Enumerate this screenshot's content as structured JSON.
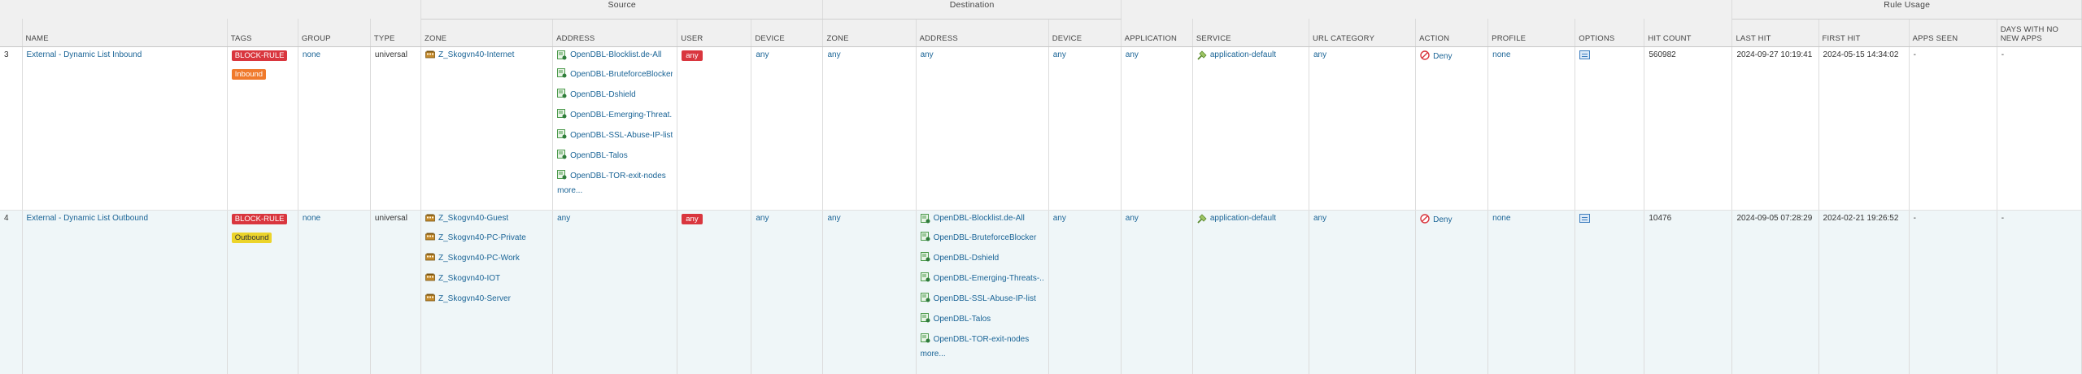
{
  "groups": {
    "source": "Source",
    "destination": "Destination",
    "rule_usage": "Rule Usage"
  },
  "columns": {
    "name": "NAME",
    "tags": "TAGS",
    "group": "GROUP",
    "type": "TYPE",
    "src_zone": "ZONE",
    "src_address": "ADDRESS",
    "src_user": "USER",
    "src_device": "DEVICE",
    "dst_zone": "ZONE",
    "dst_address": "ADDRESS",
    "dst_device": "DEVICE",
    "application": "APPLICATION",
    "service": "SERVICE",
    "url_category": "URL CATEGORY",
    "action": "ACTION",
    "profile": "PROFILE",
    "options": "OPTIONS",
    "hit_count": "HIT COUNT",
    "last_hit": "LAST HIT",
    "first_hit": "FIRST HIT",
    "apps_seen": "APPS SEEN",
    "days_no_new": "DAYS WITH NO NEW APPS"
  },
  "rows": [
    {
      "num": "3",
      "name": "External - Dynamic List Inbound",
      "tags": [
        "BLOCK-RULE",
        "Inbound"
      ],
      "group": "none",
      "type": "universal",
      "src_zone": [
        "Z_Skogvn40-Internet"
      ],
      "src_address": [
        "OpenDBL-Blocklist.de-All",
        "OpenDBL-BruteforceBlocker",
        "OpenDBL-Dshield",
        "OpenDBL-Emerging-Threat...",
        "OpenDBL-SSL-Abuse-IP-list",
        "OpenDBL-Talos",
        "OpenDBL-TOR-exit-nodes"
      ],
      "src_address_more": "more...",
      "src_user": "any",
      "src_device": "any",
      "dst_zone": "any",
      "dst_address": "any",
      "dst_device": "any",
      "application": "any",
      "service": "application-default",
      "url_category": "any",
      "action": "Deny",
      "profile": "none",
      "hit_count": "560982",
      "last_hit": "2024-09-27 10:19:41",
      "first_hit": "2024-05-15 14:34:02",
      "apps_seen": "-",
      "days_no_new": "-"
    },
    {
      "num": "4",
      "name": "External - Dynamic List Outbound",
      "tags": [
        "BLOCK-RULE",
        "Outbound"
      ],
      "group": "none",
      "type": "universal",
      "src_zone": [
        "Z_Skogvn40-Guest",
        "Z_Skogvn40-PC-Private",
        "Z_Skogvn40-PC-Work",
        "Z_Skogvn40-IOT",
        "Z_Skogvn40-Server"
      ],
      "src_address": "any",
      "src_user": "any",
      "src_device": "any",
      "dst_zone": "any",
      "dst_address": [
        "OpenDBL-Blocklist.de-All",
        "OpenDBL-BruteforceBlocker",
        "OpenDBL-Dshield",
        "OpenDBL-Emerging-Threats-...",
        "OpenDBL-SSL-Abuse-IP-list",
        "OpenDBL-Talos",
        "OpenDBL-TOR-exit-nodes"
      ],
      "dst_address_more": "more...",
      "dst_device": "any",
      "application": "any",
      "service": "application-default",
      "url_category": "any",
      "action": "Deny",
      "profile": "none",
      "hit_count": "10476",
      "last_hit": "2024-09-05 07:28:29",
      "first_hit": "2024-02-21 19:26:52",
      "apps_seen": "-",
      "days_no_new": "-"
    }
  ]
}
